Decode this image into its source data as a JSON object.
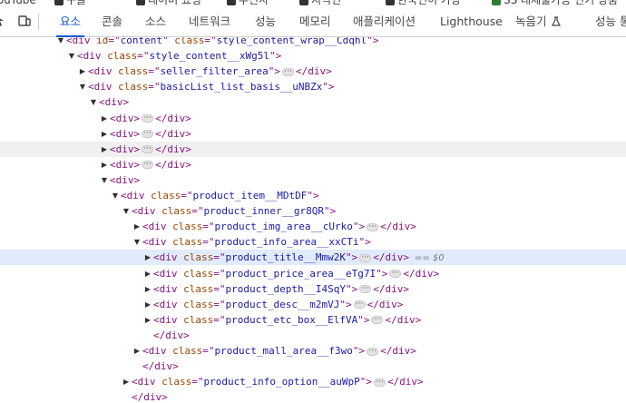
{
  "bookmarks": [
    {
      "label": "YouTube",
      "color": "#e53935"
    },
    {
      "label": "구글",
      "color": "#333333"
    },
    {
      "label": "네이버 쇼핑",
      "color": "#333333"
    },
    {
      "label": "무신사",
      "color": "#333333"
    },
    {
      "label": "지식인",
      "color": "#333333"
    },
    {
      "label": "한국인이 가장",
      "color": "#333333"
    },
    {
      "label": "SS 대체불가능 인기 상품",
      "color": "#2e7d32"
    }
  ],
  "devtools": {
    "tabs": [
      {
        "label": "요소",
        "active": true
      },
      {
        "label": "콘솔",
        "active": false
      },
      {
        "label": "소스",
        "active": false
      },
      {
        "label": "네트워크",
        "active": false
      },
      {
        "label": "성능",
        "active": false
      },
      {
        "label": "메모리",
        "active": false
      },
      {
        "label": "애플리케이션",
        "active": false
      },
      {
        "label": "Lighthouse",
        "active": false
      },
      {
        "label": "녹음기",
        "active": false
      },
      {
        "label": "성능 통",
        "active": false
      }
    ],
    "recorder_icon": "flask-icon",
    "inspect_icon": "inspect-cursor-icon",
    "device_icon": "device-toggle-icon",
    "accent_color": "#0b57d0",
    "selected_row_color": "#e0ebfb"
  },
  "dom_tree": {
    "selected_suffix": "== $0",
    "rows": [
      {
        "indent": 0,
        "arrow": "open",
        "parts": [
          {
            "t": "tag",
            "v": "<div "
          },
          {
            "t": "attr",
            "v": "id"
          },
          {
            "t": "tag",
            "v": "=\""
          },
          {
            "t": "val",
            "v": "content"
          },
          {
            "t": "tag",
            "v": "\" "
          },
          {
            "t": "attr",
            "v": "class"
          },
          {
            "t": "tag",
            "v": "=\""
          },
          {
            "t": "val",
            "v": "style_content_wrap__Cdqhl"
          },
          {
            "t": "tag",
            "v": "\">"
          }
        ]
      },
      {
        "indent": 1,
        "arrow": "open",
        "parts": [
          {
            "t": "tag",
            "v": "<div "
          },
          {
            "t": "attr",
            "v": "class"
          },
          {
            "t": "tag",
            "v": "=\""
          },
          {
            "t": "val",
            "v": "style_content__xWg5l"
          },
          {
            "t": "tag",
            "v": "\">"
          }
        ]
      },
      {
        "indent": 2,
        "arrow": "closed",
        "parts": [
          {
            "t": "tag",
            "v": "<div "
          },
          {
            "t": "attr",
            "v": "class"
          },
          {
            "t": "tag",
            "v": "=\""
          },
          {
            "t": "val",
            "v": "seller_filter_area"
          },
          {
            "t": "tag",
            "v": "\">"
          },
          {
            "t": "ell",
            "v": "···"
          },
          {
            "t": "tag",
            "v": "</div>"
          }
        ]
      },
      {
        "indent": 2,
        "arrow": "open",
        "parts": [
          {
            "t": "tag",
            "v": "<div "
          },
          {
            "t": "attr",
            "v": "class"
          },
          {
            "t": "tag",
            "v": "=\""
          },
          {
            "t": "val",
            "v": "basicList_list_basis__uNBZx"
          },
          {
            "t": "tag",
            "v": "\">"
          }
        ]
      },
      {
        "indent": 3,
        "arrow": "open",
        "parts": [
          {
            "t": "tag",
            "v": "<div>"
          }
        ]
      },
      {
        "indent": 4,
        "arrow": "closed",
        "parts": [
          {
            "t": "tag",
            "v": "<div>"
          },
          {
            "t": "ell",
            "v": "···"
          },
          {
            "t": "tag",
            "v": "</div>"
          }
        ]
      },
      {
        "indent": 4,
        "arrow": "closed",
        "parts": [
          {
            "t": "tag",
            "v": "<div>"
          },
          {
            "t": "ell",
            "v": "···"
          },
          {
            "t": "tag",
            "v": "</div>"
          }
        ]
      },
      {
        "indent": 4,
        "arrow": "closed",
        "state": "hover",
        "parts": [
          {
            "t": "tag",
            "v": "<div>"
          },
          {
            "t": "ell",
            "v": "···"
          },
          {
            "t": "tag",
            "v": "</div>"
          }
        ]
      },
      {
        "indent": 4,
        "arrow": "closed",
        "parts": [
          {
            "t": "tag",
            "v": "<div>"
          },
          {
            "t": "ell",
            "v": "···"
          },
          {
            "t": "tag",
            "v": "</div>"
          }
        ]
      },
      {
        "indent": 4,
        "arrow": "open",
        "parts": [
          {
            "t": "tag",
            "v": "<div>"
          }
        ]
      },
      {
        "indent": 5,
        "arrow": "open",
        "parts": [
          {
            "t": "tag",
            "v": "<div "
          },
          {
            "t": "attr",
            "v": "class"
          },
          {
            "t": "tag",
            "v": "=\""
          },
          {
            "t": "val",
            "v": "product_item__MDtDF"
          },
          {
            "t": "tag",
            "v": "\">"
          }
        ]
      },
      {
        "indent": 6,
        "arrow": "open",
        "parts": [
          {
            "t": "tag",
            "v": "<div "
          },
          {
            "t": "attr",
            "v": "class"
          },
          {
            "t": "tag",
            "v": "=\""
          },
          {
            "t": "val",
            "v": "product_inner__gr8QR"
          },
          {
            "t": "tag",
            "v": "\">"
          }
        ]
      },
      {
        "indent": 7,
        "arrow": "closed",
        "parts": [
          {
            "t": "tag",
            "v": "<div "
          },
          {
            "t": "attr",
            "v": "class"
          },
          {
            "t": "tag",
            "v": "=\""
          },
          {
            "t": "val",
            "v": "product_img_area__cUrko"
          },
          {
            "t": "tag",
            "v": "\">"
          },
          {
            "t": "ell",
            "v": "···"
          },
          {
            "t": "tag",
            "v": "</div>"
          }
        ]
      },
      {
        "indent": 7,
        "arrow": "open",
        "parts": [
          {
            "t": "tag",
            "v": "<div "
          },
          {
            "t": "attr",
            "v": "class"
          },
          {
            "t": "tag",
            "v": "=\""
          },
          {
            "t": "val",
            "v": "product_info_area__xxCTi"
          },
          {
            "t": "tag",
            "v": "\">"
          }
        ]
      },
      {
        "indent": 8,
        "arrow": "closed",
        "state": "selected",
        "parts": [
          {
            "t": "tag",
            "v": "<div "
          },
          {
            "t": "attr",
            "v": "class"
          },
          {
            "t": "tag",
            "v": "=\""
          },
          {
            "t": "val",
            "v": "product_title__Mmw2K"
          },
          {
            "t": "tag",
            "v": "\">"
          },
          {
            "t": "ell",
            "v": "···"
          },
          {
            "t": "tag",
            "v": "</div>"
          },
          {
            "t": "dollar",
            "v": "== $0"
          }
        ]
      },
      {
        "indent": 8,
        "arrow": "closed",
        "parts": [
          {
            "t": "tag",
            "v": "<div "
          },
          {
            "t": "attr",
            "v": "class"
          },
          {
            "t": "tag",
            "v": "=\""
          },
          {
            "t": "val",
            "v": "product_price_area__eTg7I"
          },
          {
            "t": "tag",
            "v": "\">"
          },
          {
            "t": "ell",
            "v": "···"
          },
          {
            "t": "tag",
            "v": "</div>"
          }
        ]
      },
      {
        "indent": 8,
        "arrow": "closed",
        "parts": [
          {
            "t": "tag",
            "v": "<div "
          },
          {
            "t": "attr",
            "v": "class"
          },
          {
            "t": "tag",
            "v": "=\""
          },
          {
            "t": "val",
            "v": "product_depth__I4SqY"
          },
          {
            "t": "tag",
            "v": "\">"
          },
          {
            "t": "ell",
            "v": "···"
          },
          {
            "t": "tag",
            "v": "</div>"
          }
        ]
      },
      {
        "indent": 8,
        "arrow": "closed",
        "parts": [
          {
            "t": "tag",
            "v": "<div "
          },
          {
            "t": "attr",
            "v": "class"
          },
          {
            "t": "tag",
            "v": "=\""
          },
          {
            "t": "val",
            "v": "product_desc__m2mVJ"
          },
          {
            "t": "tag",
            "v": "\">"
          },
          {
            "t": "ell",
            "v": "···"
          },
          {
            "t": "tag",
            "v": "</div>"
          }
        ]
      },
      {
        "indent": 8,
        "arrow": "closed",
        "parts": [
          {
            "t": "tag",
            "v": "<div "
          },
          {
            "t": "attr",
            "v": "class"
          },
          {
            "t": "tag",
            "v": "=\""
          },
          {
            "t": "val",
            "v": "product_etc_box__ElfVA"
          },
          {
            "t": "tag",
            "v": "\">"
          },
          {
            "t": "ell",
            "v": "···"
          },
          {
            "t": "tag",
            "v": "</div>"
          }
        ]
      },
      {
        "indent": 8,
        "arrow": "none",
        "parts": [
          {
            "t": "tag",
            "v": "</div>"
          }
        ]
      },
      {
        "indent": 7,
        "arrow": "closed",
        "parts": [
          {
            "t": "tag",
            "v": "<div "
          },
          {
            "t": "attr",
            "v": "class"
          },
          {
            "t": "tag",
            "v": "=\""
          },
          {
            "t": "val",
            "v": "product_mall_area__f3wo"
          },
          {
            "t": "tag",
            "v": "\">"
          },
          {
            "t": "ell",
            "v": "···"
          },
          {
            "t": "tag",
            "v": "</div>"
          }
        ]
      },
      {
        "indent": 7,
        "arrow": "none",
        "parts": [
          {
            "t": "tag",
            "v": "</div>"
          }
        ]
      },
      {
        "indent": 6,
        "arrow": "closed",
        "parts": [
          {
            "t": "tag",
            "v": "<div "
          },
          {
            "t": "attr",
            "v": "class"
          },
          {
            "t": "tag",
            "v": "=\""
          },
          {
            "t": "val",
            "v": "product_info_option__auWpP"
          },
          {
            "t": "tag",
            "v": "\">"
          },
          {
            "t": "ell",
            "v": "···"
          },
          {
            "t": "tag",
            "v": "</div>"
          }
        ]
      },
      {
        "indent": 6,
        "arrow": "none",
        "parts": [
          {
            "t": "tag",
            "v": "</div>"
          }
        ]
      }
    ]
  }
}
